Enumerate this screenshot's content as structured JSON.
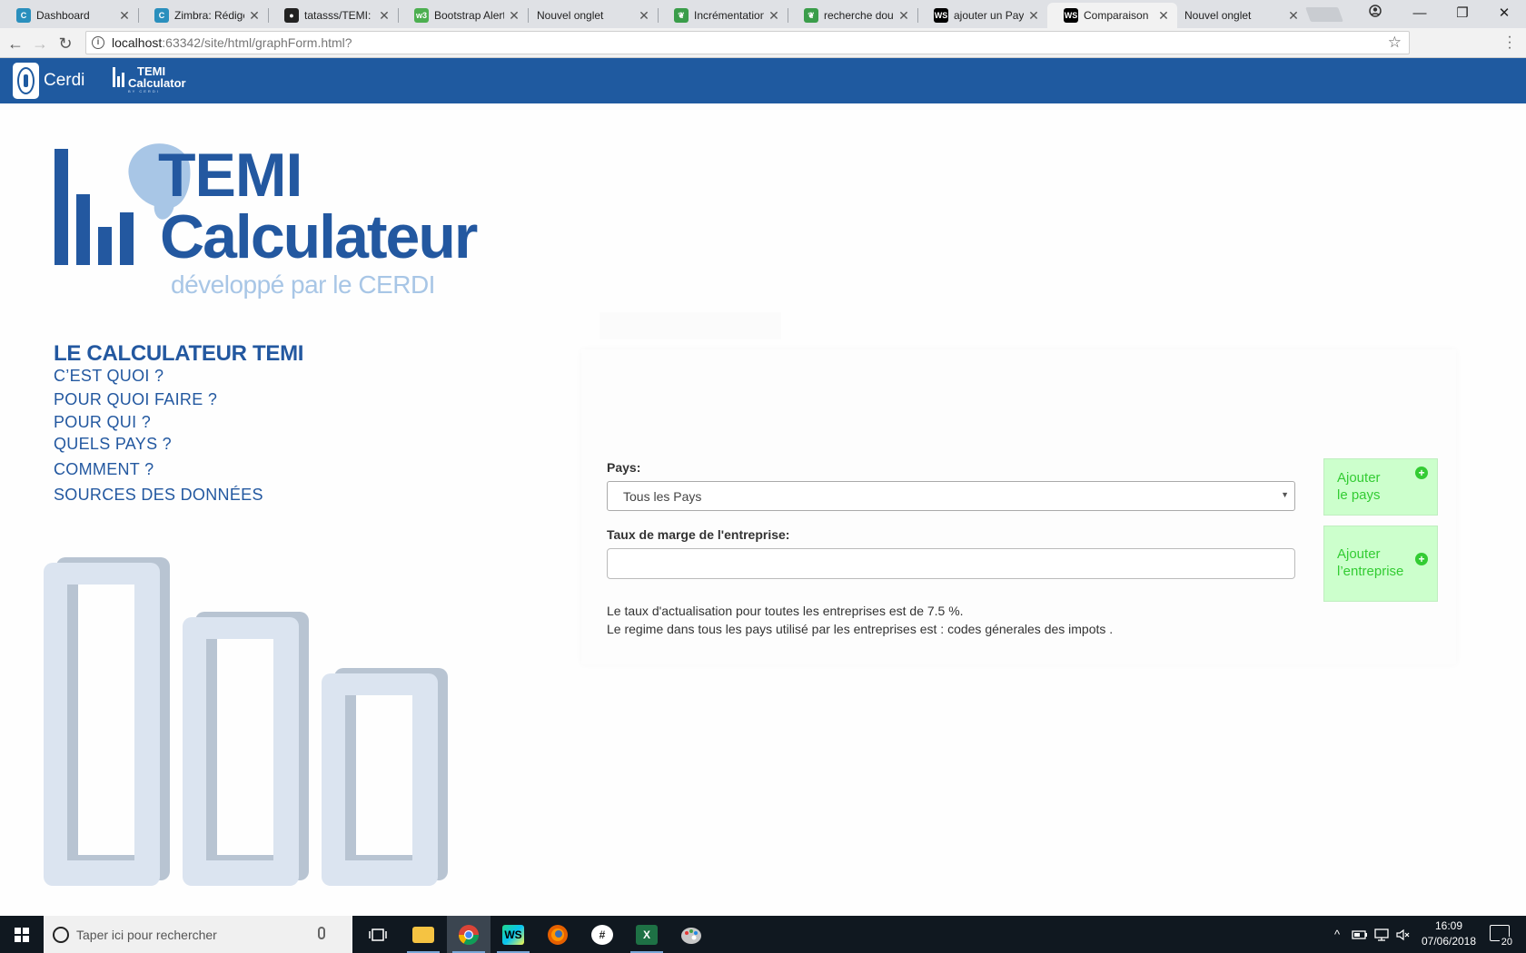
{
  "browser": {
    "tabs": [
      {
        "title": "Dashboard",
        "icon": "cerdi-icon",
        "color": "#2a8fbd"
      },
      {
        "title": "Zimbra: Rédiger",
        "icon": "cerdi-icon",
        "color": "#2a8fbd"
      },
      {
        "title": "tatasss/TEMI: Le",
        "icon": "github-icon",
        "color": "#222222"
      },
      {
        "title": "Bootstrap Alerts",
        "icon": "w3schools-icon",
        "color": "#4caf50"
      },
      {
        "title": "Nouvel onglet",
        "icon": "",
        "color": ""
      },
      {
        "title": "Incrémentation",
        "icon": "leaf-icon",
        "color": "#3a9d4a"
      },
      {
        "title": "recherche doub",
        "icon": "leaf-icon",
        "color": "#3a9d4a"
      },
      {
        "title": "ajouter un Pays",
        "icon": "webstorm-icon",
        "color": "#000000"
      },
      {
        "title": "Comparaison",
        "icon": "webstorm-icon",
        "color": "#000000"
      },
      {
        "title": "Nouvel onglet",
        "icon": "",
        "color": ""
      }
    ],
    "active_tab_index": 8,
    "url_host": "localhost",
    "url_path": ":63342/site/html/graphForm.html?"
  },
  "navbar": {
    "brand": "Cerdi",
    "temi_line1": "TEMI",
    "temi_line2": "Calculator",
    "temi_sub": "BY CERDI",
    "color": "#1f5aa0"
  },
  "hero": {
    "title_line1": "TEMI",
    "title_line2": "Calculateur",
    "subtitle": "développé par  le CERDI"
  },
  "menu": {
    "heading": "LE CALCULATEUR TEMI",
    "items": [
      "C’EST QUOI ?",
      "POUR QUOI FAIRE ?",
      "POUR QUI ?",
      "QUELS PAYS ?",
      "COMMENT ?",
      "SOURCES DES DONNÉES"
    ]
  },
  "form": {
    "country_label": "Pays:",
    "country_value": "Tous les Pays",
    "margin_label": "Taux de marge de l'entreprise:",
    "margin_value": "",
    "info_line1": "Le taux d'actualisation pour toutes les entreprises est de 7.5 %.",
    "info_line2": "Le regime dans tous les pays utilisé par les entreprises est : codes génerales des impots .",
    "add_country_line1": "Ajouter",
    "add_country_line2": "le pays",
    "add_company_line1": "Ajouter",
    "add_company_line2": "l’entreprise",
    "button_color": "#ccffcc",
    "button_text_color": "#33cc33"
  },
  "taskbar": {
    "search_placeholder": "Taper ici pour rechercher",
    "time": "16:09",
    "date": "07/06/2018",
    "notifications": "20"
  }
}
